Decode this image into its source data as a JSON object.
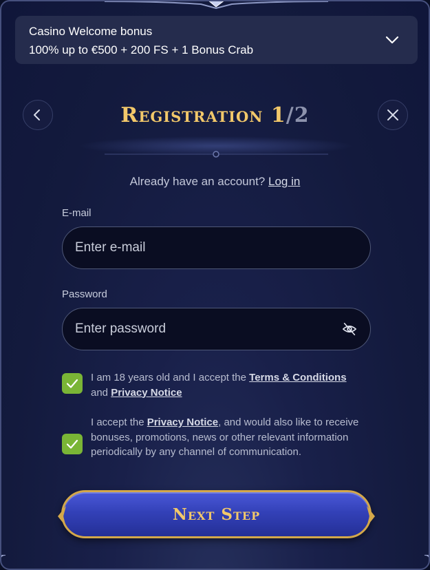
{
  "bonus": {
    "title": "Casino Welcome bonus",
    "value": "100% up to €500 + 200 FS + 1 Bonus Crab"
  },
  "header": {
    "title": "Registration 1",
    "step_total": "/2"
  },
  "login": {
    "prompt": "Already have an account?",
    "link": "Log in"
  },
  "email": {
    "label": "E-mail",
    "placeholder": "Enter e-mail",
    "value": ""
  },
  "password": {
    "label": "Password",
    "placeholder": "Enter password",
    "value": ""
  },
  "consents": [
    {
      "checked": true,
      "text_1": "I am 18 years old and I accept the ",
      "link_1": "Terms & Conditions",
      "text_2": " and ",
      "link_2": "Privacy Notice"
    },
    {
      "checked": true,
      "text_1": "I accept the ",
      "link_1": "Privacy Notice",
      "text_2": ", and would also like to receive bonuses, promotions, news or other relevant information periodically by any channel of communication."
    }
  ],
  "next_button": {
    "label": "Next Step"
  },
  "colors": {
    "gold": "#f2c86a",
    "checkbox_green": "#7ab536",
    "button_blue": "#3341b8",
    "panel_bg": "#19204a"
  },
  "icons": {
    "bonus_toggle": "chevron-down-icon",
    "back": "chevron-left-icon",
    "close": "close-icon",
    "password_toggle": "eye-off-icon",
    "checkbox": "checkmark-icon"
  }
}
